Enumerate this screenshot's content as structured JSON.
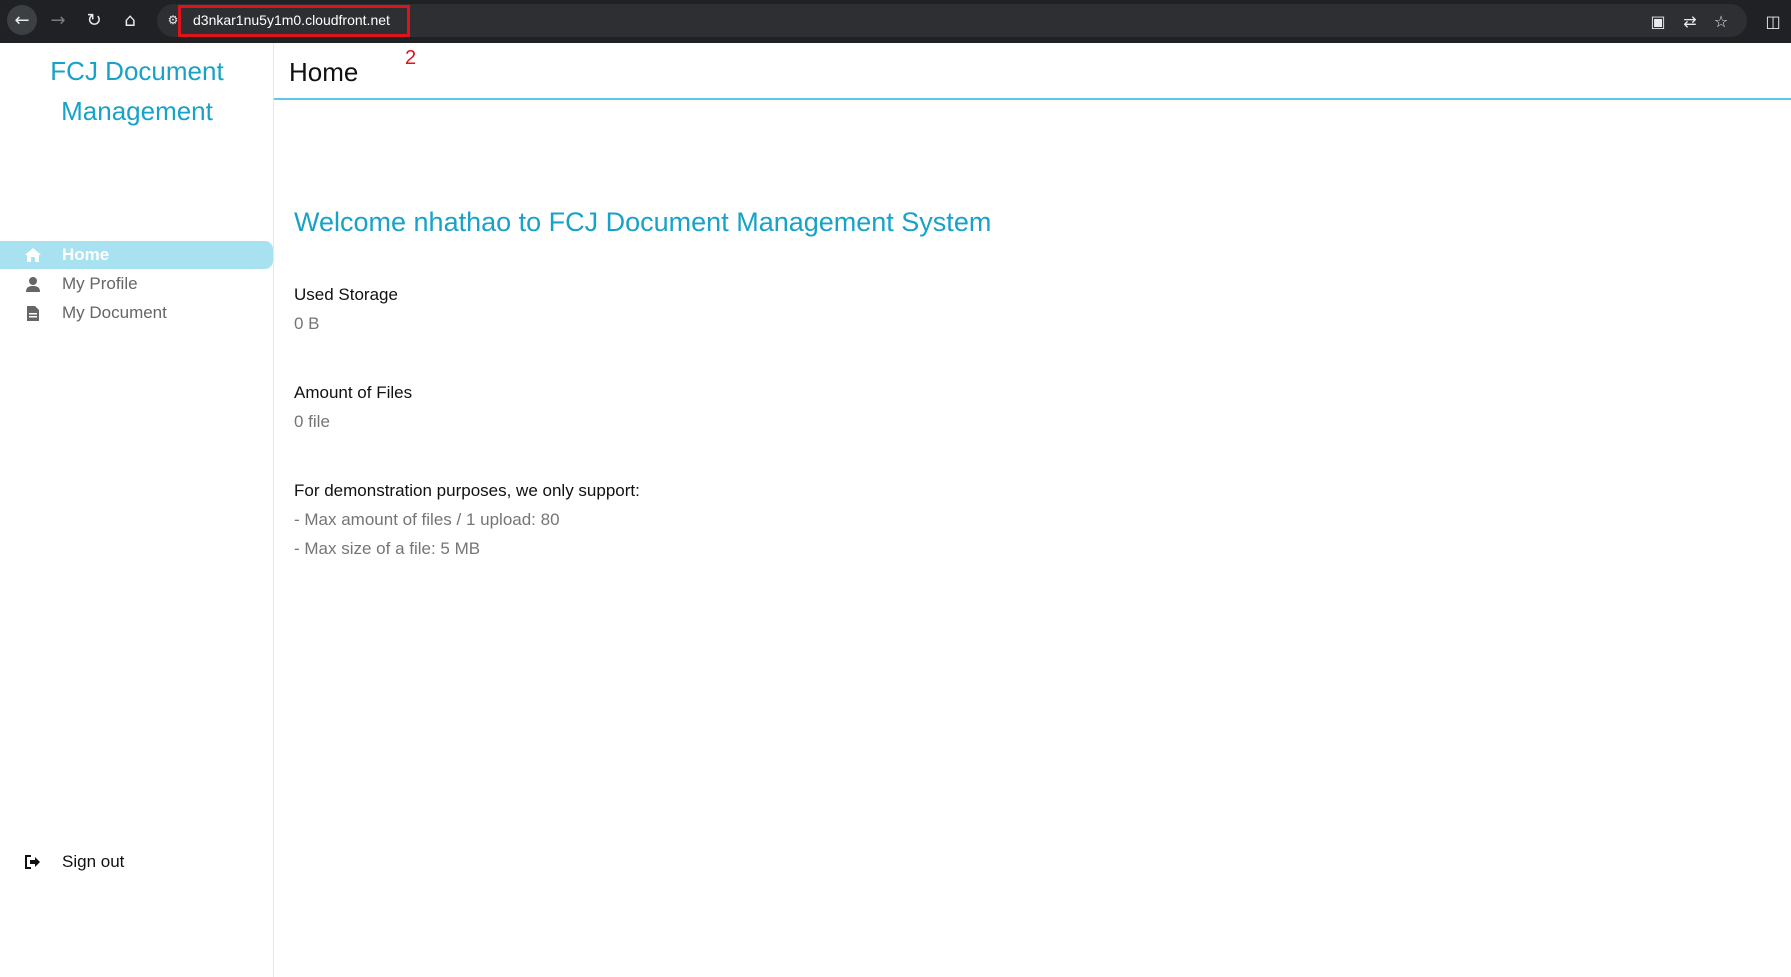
{
  "browser": {
    "url": "d3nkar1nu5y1m0.cloudfront.net",
    "annotation_number": "2",
    "icons": [
      "back-arrow-icon",
      "forward-arrow-icon",
      "reload-icon",
      "home-icon",
      "site-info-icon",
      "install-app-icon",
      "translate-icon",
      "bookmark-star-icon",
      "extensions-icon"
    ]
  },
  "app": {
    "brand_line1": "FCJ Document",
    "brand_line2": "Management",
    "accent_color": "#17a2c7",
    "active_menu_bg": "#a8e1ef"
  },
  "sidebar": {
    "items": [
      {
        "label": "Home",
        "icon": "home-icon",
        "active": true
      },
      {
        "label": "My Profile",
        "icon": "user-icon",
        "active": false
      },
      {
        "label": "My Document",
        "icon": "document-icon",
        "active": false
      }
    ],
    "signout_label": "Sign out"
  },
  "header": {
    "title": "Home"
  },
  "main": {
    "welcome": "Welcome nhathao to FCJ Document Management System",
    "used_storage_label": "Used Storage",
    "used_storage_value": "0 B",
    "amount_files_label": "Amount of Files",
    "amount_files_value": "0 file",
    "support_label": "For demonstration purposes, we only support:",
    "support_items": [
      "- Max amount of files / 1 upload: 80",
      "- Max size of a file: 5 MB"
    ]
  }
}
